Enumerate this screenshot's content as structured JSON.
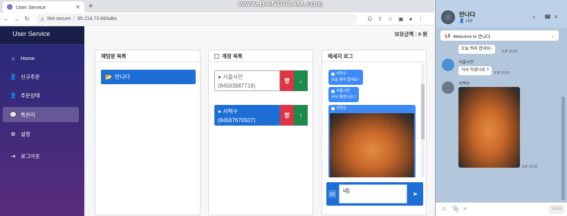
{
  "browser": {
    "tab_title": "User Service",
    "not_secure": "Not secure",
    "url": "95.216.73.88/talks",
    "watermark": "www.BANDICAM.com"
  },
  "sidebar": {
    "brand": "User Service",
    "items": [
      {
        "label": "Home",
        "icon": "home-icon"
      },
      {
        "label": "신규주문",
        "icon": "user-plus-icon"
      },
      {
        "label": "주문상태",
        "icon": "user-check-icon"
      },
      {
        "label": "톡관리",
        "icon": "chat-icon"
      },
      {
        "label": "설정",
        "icon": "gear-icon"
      },
      {
        "label": "로그아웃",
        "icon": "logout-icon"
      }
    ]
  },
  "main": {
    "balance": "보유금액 : 0 원",
    "room_panel": {
      "title": "채팅방 목록",
      "rooms": [
        "만나다"
      ]
    },
    "account_panel": {
      "title": "계정 목록",
      "accounts": [
        {
          "name": "서울시민",
          "phone": "(84583987718)"
        },
        {
          "name": "서혁수",
          "phone": "(84567670507)"
        }
      ]
    },
    "message_panel": {
      "title": "메세지 로그",
      "messages": [
        {
          "sender": "서혁수",
          "text": "오늘 뭐지 합네요~"
        },
        {
          "sender": "서울시민",
          "text": "식사 해셨나요 ?"
        },
        {
          "sender": "서혁수",
          "text": ""
        }
      ],
      "input_value": "네|"
    }
  },
  "mobile": {
    "room_title": "만나다",
    "member_count": "159",
    "notice": "Welcome to 만나다",
    "messages": [
      {
        "sender": "",
        "text": "오늘 뭐지 합네요~",
        "time": "오후 10:50"
      },
      {
        "sender": "서울시민",
        "text": "식사 하셨나요 ?",
        "time": "오후 10:50"
      },
      {
        "sender": "서혁수",
        "text": "",
        "time": "오후 10:50"
      }
    ],
    "send_label": "Send"
  }
}
